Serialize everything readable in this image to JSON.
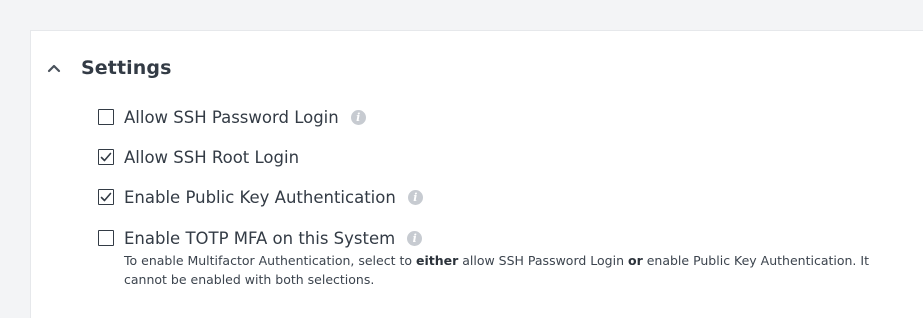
{
  "settings": {
    "title": "Settings",
    "toggle_icon": "chevron-up-icon",
    "options": [
      {
        "label": "Allow SSH Password Login",
        "checked": false,
        "info_icon": "info-icon"
      },
      {
        "label": "Allow SSH Root Login",
        "checked": true
      },
      {
        "label": "Enable Public Key Authentication",
        "checked": true,
        "info_icon": "info-icon"
      },
      {
        "label": "Enable TOTP MFA on this System",
        "checked": false,
        "info_icon": "info-icon"
      }
    ],
    "help": {
      "part1": "To enable Multifactor Authentication, select to ",
      "bold1": "either",
      "part2": " allow SSH Password Login ",
      "bold2": "or",
      "part3": " enable Public Key Authentication. It cannot be enabled with both selections."
    },
    "info_glyph": "i"
  },
  "colors": {
    "text": "#333b45",
    "info_icon": "#c7cbd1",
    "background": "#f3f4f6",
    "panel": "#ffffff"
  }
}
